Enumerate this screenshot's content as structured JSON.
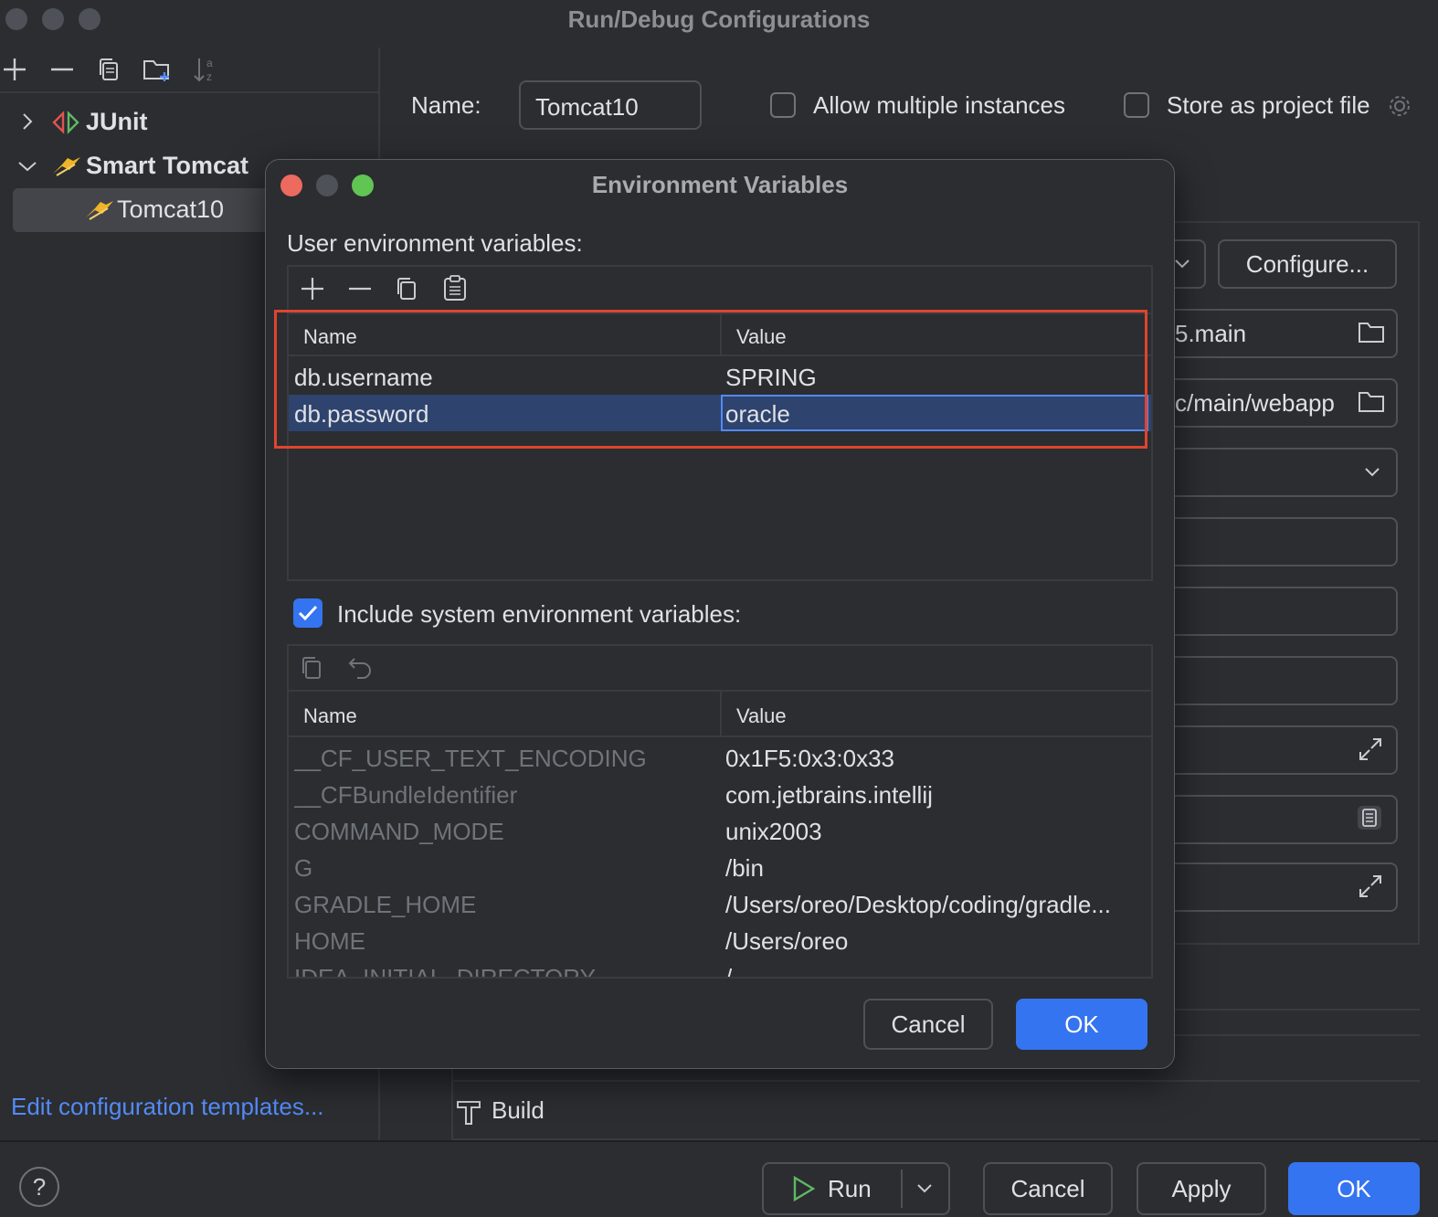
{
  "window": {
    "title": "Run/Debug Configurations"
  },
  "tree": {
    "items": [
      {
        "label": "JUnit"
      },
      {
        "label": "Smart Tomcat"
      },
      {
        "label": "Tomcat10"
      }
    ],
    "edit_templates_link": "Edit configuration templates..."
  },
  "config": {
    "name_label": "Name:",
    "name_value": "Tomcat10",
    "allow_multiple_label": "Allow multiple instances",
    "store_as_project_label": "Store as project file",
    "configure_button": "Configure...",
    "field_main": "5.main",
    "field_webapp": "c/main/webapp",
    "build_label": "Build"
  },
  "footer": {
    "run_label": "Run",
    "cancel_label": "Cancel",
    "apply_label": "Apply",
    "ok_label": "OK"
  },
  "dialog": {
    "title": "Environment Variables",
    "user_section_label": "User environment variables:",
    "columns": [
      "Name",
      "Value"
    ],
    "user_vars": [
      {
        "name": "db.username",
        "value": "SPRING"
      },
      {
        "name": "db.password",
        "value": "oracle"
      }
    ],
    "include_system_label": "Include system environment variables:",
    "include_system_checked": true,
    "system_vars": [
      {
        "name": "__CF_USER_TEXT_ENCODING",
        "value": "0x1F5:0x3:0x33"
      },
      {
        "name": "__CFBundleIdentifier",
        "value": "com.jetbrains.intellij"
      },
      {
        "name": "COMMAND_MODE",
        "value": "unix2003"
      },
      {
        "name": "G",
        "value": "/bin"
      },
      {
        "name": "GRADLE_HOME",
        "value": "/Users/oreo/Desktop/coding/gradle..."
      },
      {
        "name": "HOME",
        "value": "/Users/oreo"
      },
      {
        "name": "IDEA_INITIAL_DIRECTORY",
        "value": "/"
      }
    ],
    "cancel_label": "Cancel",
    "ok_label": "OK"
  },
  "colors": {
    "background": "#2b2d30",
    "accent": "#3574f0",
    "selection": "#2e436e",
    "highlight_box": "#e0442e",
    "link": "#548af7"
  }
}
